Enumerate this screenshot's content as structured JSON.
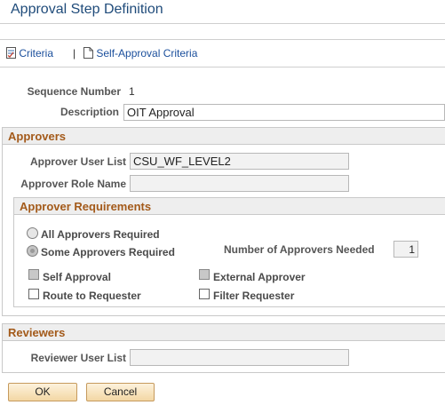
{
  "page": {
    "title": "Approval Step Definition"
  },
  "toolbar": {
    "criteria_label": "Criteria",
    "separator": "|",
    "self_approval_criteria_label": "Self-Approval Criteria"
  },
  "fields": {
    "sequence_number_label": "Sequence Number",
    "sequence_number_value": "1",
    "description_label": "Description",
    "description_value": "OIT Approval"
  },
  "approvers": {
    "header": "Approvers",
    "user_list_label": "Approver User List",
    "user_list_value": "CSU_WF_LEVEL2",
    "role_name_label": "Approver Role Name",
    "role_name_value": ""
  },
  "requirements": {
    "header": "Approver Requirements",
    "all_required_label": "All Approvers Required",
    "some_required_label": "Some Approvers Required",
    "selected_option": "Some Approvers Required",
    "number_needed_label": "Number of Approvers Needed",
    "number_needed_value": "1",
    "self_approval_label": "Self Approval",
    "external_approver_label": "External Approver",
    "route_to_requester_label": "Route to Requester",
    "filter_requester_label": "Filter Requester"
  },
  "reviewers": {
    "header": "Reviewers",
    "user_list_label": "Reviewer User List",
    "user_list_value": ""
  },
  "buttons": {
    "ok_label": "OK",
    "cancel_label": "Cancel"
  }
}
